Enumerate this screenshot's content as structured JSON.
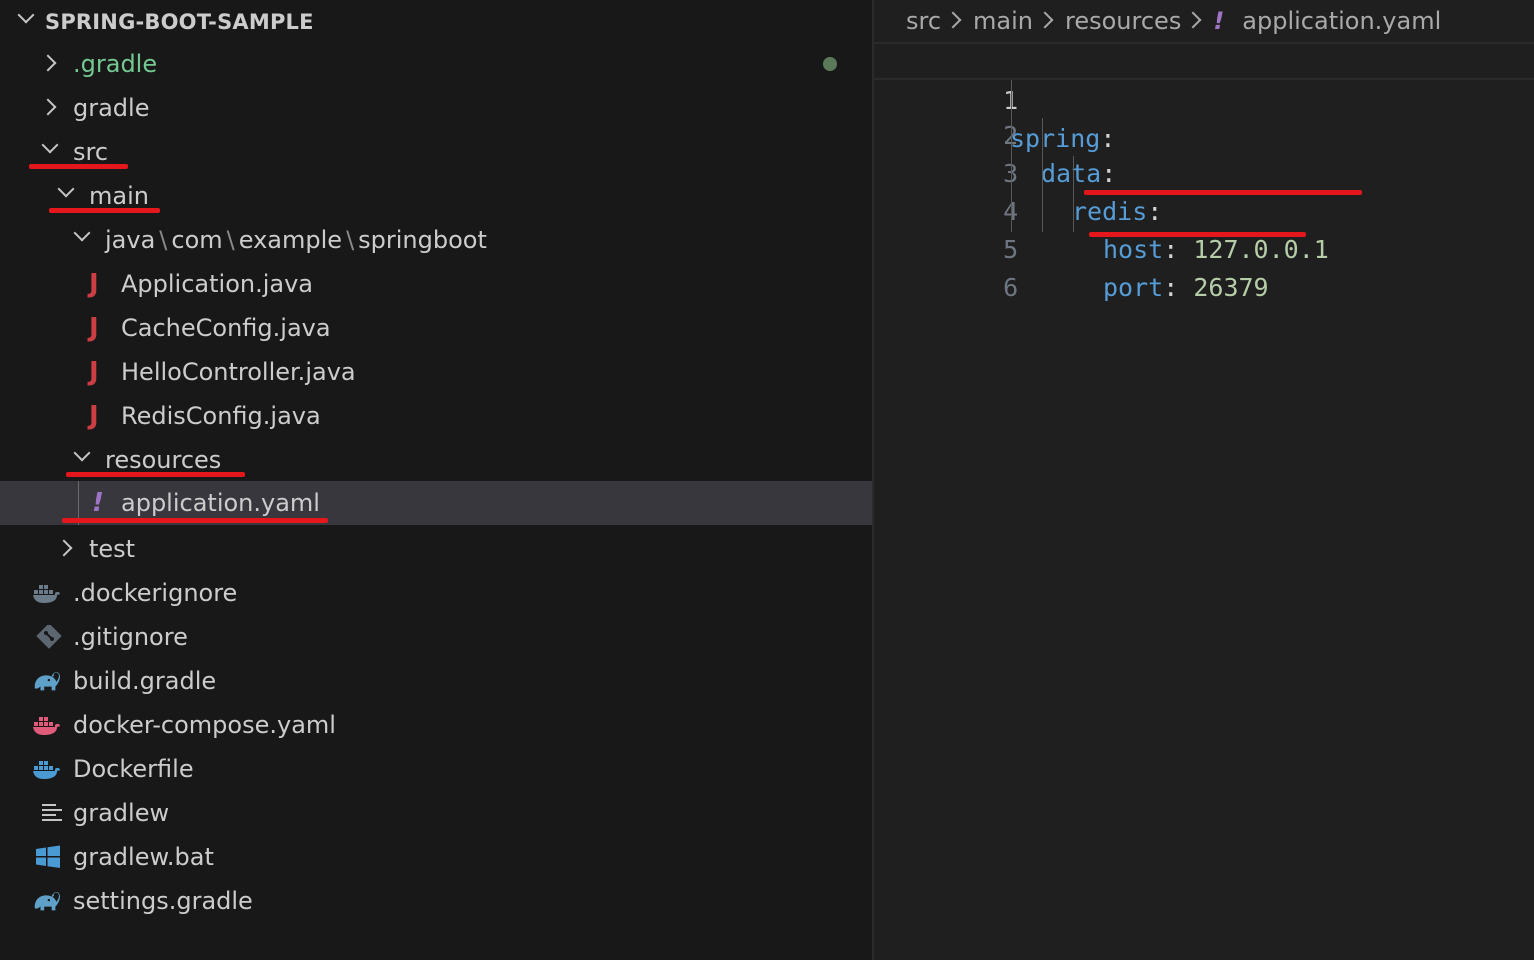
{
  "explorer": {
    "project": "SPRING-BOOT-SAMPLE",
    "items": [
      {
        "label": ".gradle",
        "chevron": "right",
        "color": "#73c991"
      },
      {
        "label": "gradle",
        "chevron": "right"
      },
      {
        "label": "src",
        "chevron": "down"
      },
      {
        "label": "main",
        "chevron": "down"
      },
      {
        "parts": [
          "java",
          "com",
          "example",
          "springboot"
        ],
        "chevron": "down"
      },
      {
        "label": "Application.java",
        "icon": "java-icon"
      },
      {
        "label": "CacheConfig.java",
        "icon": "java-icon"
      },
      {
        "label": "HelloController.java",
        "icon": "java-icon"
      },
      {
        "label": "RedisConfig.java",
        "icon": "java-icon"
      },
      {
        "label": "resources",
        "chevron": "down"
      },
      {
        "label": "application.yaml",
        "icon": "yaml-icon",
        "selected": true
      },
      {
        "label": "test",
        "chevron": "right"
      },
      {
        "label": ".dockerignore",
        "icon": "docker-icon"
      },
      {
        "label": ".gitignore",
        "icon": "git-icon"
      },
      {
        "label": "build.gradle",
        "icon": "gradle-elephant-icon"
      },
      {
        "label": "docker-compose.yaml",
        "icon": "docker-compose-icon"
      },
      {
        "label": "Dockerfile",
        "icon": "docker-icon"
      },
      {
        "label": "gradlew",
        "icon": "text-lines-icon"
      },
      {
        "label": "gradlew.bat",
        "icon": "windows-icon"
      },
      {
        "label": "settings.gradle",
        "icon": "gradle-elephant-icon"
      }
    ],
    "java_glyph": "J",
    "yaml_glyph": "!"
  },
  "editor": {
    "breadcrumb": [
      "src",
      "main",
      "resources",
      "application.yaml"
    ],
    "breadcrumb_glyph": "!",
    "lines": [
      {
        "n": "1",
        "key": "spring",
        "value": ""
      },
      {
        "n": "2",
        "key": "data",
        "value": ""
      },
      {
        "n": "3",
        "key": "redis",
        "value": ""
      },
      {
        "n": "4",
        "key": "host",
        "value": "127.0.0.1"
      },
      {
        "n": "5",
        "key": "port",
        "value": "26379"
      },
      {
        "n": "6",
        "key": "",
        "value": ""
      }
    ],
    "colon": ":"
  },
  "colors": {
    "key": "#569cd6",
    "value": "#b5cea8",
    "annotation": "#e5171d",
    "java": "#cc3e44",
    "yaml": "#a074c4"
  }
}
